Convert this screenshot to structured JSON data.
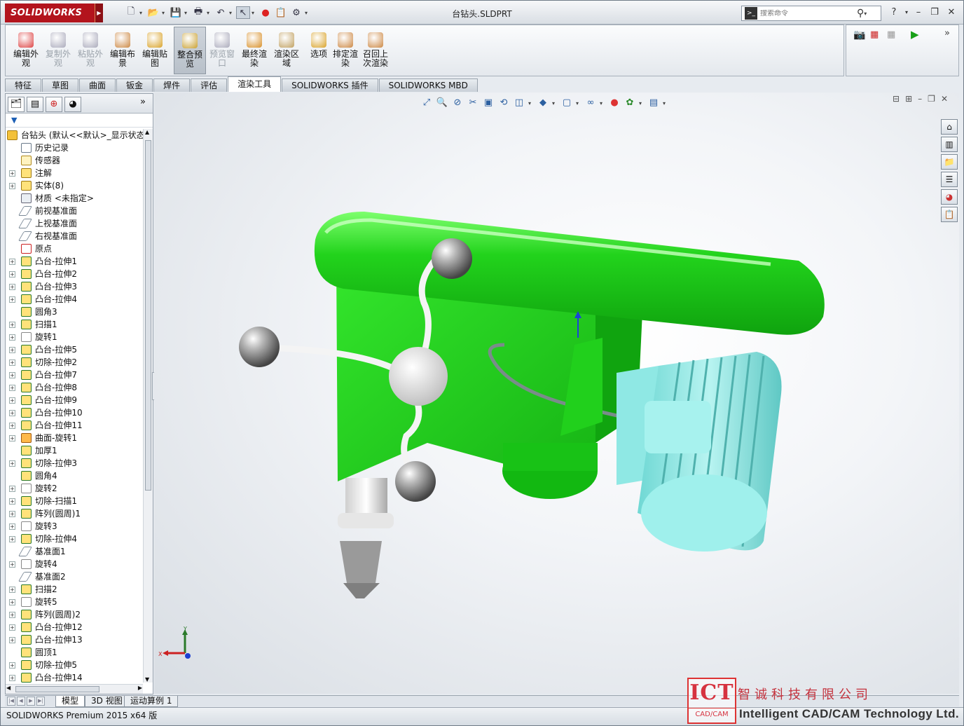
{
  "app": {
    "logo": "SOLIDWORKS",
    "document_title": "台钻头.SLDPRT"
  },
  "search": {
    "placeholder": "搜索命令"
  },
  "ribbon": {
    "buttons": [
      {
        "label": "编辑外\n观",
        "state": "normal"
      },
      {
        "label": "复制外\n观",
        "state": "disabled"
      },
      {
        "label": "粘贴外\n观",
        "state": "disabled"
      },
      {
        "label": "编辑布\n景",
        "state": "normal"
      },
      {
        "label": "编辑贴\n图",
        "state": "normal"
      },
      {
        "label": "整合预\n览",
        "state": "active"
      },
      {
        "label": "预览窗\n口",
        "state": "disabled"
      },
      {
        "label": "最终渲\n染",
        "state": "normal"
      },
      {
        "label": "渲染区\n域",
        "state": "normal"
      },
      {
        "label": "选项",
        "state": "normal"
      },
      {
        "label": "排定渲\n染",
        "state": "normal"
      },
      {
        "label": "召回上\n次渲染",
        "state": "normal"
      }
    ]
  },
  "tabs": [
    "特征",
    "草图",
    "曲面",
    "钣金",
    "焊件",
    "评估",
    "渲染工具",
    "SOLIDWORKS 插件",
    "SOLIDWORKS MBD"
  ],
  "active_tab": "渲染工具",
  "feature_tree": {
    "root": "台钻头  (默认<<默认>_显示状态",
    "items": [
      {
        "label": "历史记录",
        "expand": false,
        "icon": "history-icon"
      },
      {
        "label": "传感器",
        "expand": false,
        "icon": "sensor-icon"
      },
      {
        "label": "注解",
        "expand": true,
        "icon": "annotation-icon"
      },
      {
        "label": "实体(8)",
        "expand": true,
        "icon": "solid-body-icon"
      },
      {
        "label": "材质 <未指定>",
        "expand": false,
        "icon": "material-icon"
      },
      {
        "label": "前视基准面",
        "expand": false,
        "icon": "plane-icon"
      },
      {
        "label": "上视基准面",
        "expand": false,
        "icon": "plane-icon"
      },
      {
        "label": "右视基准面",
        "expand": false,
        "icon": "plane-icon"
      },
      {
        "label": "原点",
        "expand": false,
        "icon": "origin-icon"
      },
      {
        "label": "凸台-拉伸1",
        "expand": true,
        "icon": "boss-extrude-icon"
      },
      {
        "label": "凸台-拉伸2",
        "expand": true,
        "icon": "boss-extrude-icon"
      },
      {
        "label": "凸台-拉伸3",
        "expand": true,
        "icon": "boss-extrude-icon"
      },
      {
        "label": "凸台-拉伸4",
        "expand": true,
        "icon": "boss-extrude-icon"
      },
      {
        "label": "圆角3",
        "expand": false,
        "icon": "fillet-icon"
      },
      {
        "label": "扫描1",
        "expand": true,
        "icon": "sweep-icon"
      },
      {
        "label": "旋转1",
        "expand": true,
        "icon": "revolve-icon"
      },
      {
        "label": "凸台-拉伸5",
        "expand": true,
        "icon": "boss-extrude-icon"
      },
      {
        "label": "切除-拉伸2",
        "expand": true,
        "icon": "cut-extrude-icon"
      },
      {
        "label": "凸台-拉伸7",
        "expand": true,
        "icon": "boss-extrude-icon"
      },
      {
        "label": "凸台-拉伸8",
        "expand": true,
        "icon": "boss-extrude-icon"
      },
      {
        "label": "凸台-拉伸9",
        "expand": true,
        "icon": "boss-extrude-icon"
      },
      {
        "label": "凸台-拉伸10",
        "expand": true,
        "icon": "boss-extrude-icon"
      },
      {
        "label": "凸台-拉伸11",
        "expand": true,
        "icon": "boss-extrude-icon"
      },
      {
        "label": "曲面-旋转1",
        "expand": true,
        "icon": "surface-revolve-icon"
      },
      {
        "label": "加厚1",
        "expand": false,
        "icon": "thicken-icon"
      },
      {
        "label": "切除-拉伸3",
        "expand": true,
        "icon": "cut-extrude-icon"
      },
      {
        "label": "圆角4",
        "expand": false,
        "icon": "fillet-icon"
      },
      {
        "label": "旋转2",
        "expand": true,
        "icon": "revolve-icon"
      },
      {
        "label": "切除-扫描1",
        "expand": true,
        "icon": "cut-sweep-icon"
      },
      {
        "label": "阵列(圆周)1",
        "expand": true,
        "icon": "circular-pattern-icon"
      },
      {
        "label": "旋转3",
        "expand": true,
        "icon": "revolve-icon"
      },
      {
        "label": "切除-拉伸4",
        "expand": true,
        "icon": "cut-extrude-icon"
      },
      {
        "label": "基准面1",
        "expand": false,
        "icon": "plane-icon"
      },
      {
        "label": "旋转4",
        "expand": true,
        "icon": "revolve-icon"
      },
      {
        "label": "基准面2",
        "expand": false,
        "icon": "plane-icon"
      },
      {
        "label": "扫描2",
        "expand": true,
        "icon": "sweep-icon"
      },
      {
        "label": "旋转5",
        "expand": true,
        "icon": "revolve-icon"
      },
      {
        "label": "阵列(圆周)2",
        "expand": true,
        "icon": "circular-pattern-icon"
      },
      {
        "label": "凸台-拉伸12",
        "expand": true,
        "icon": "boss-extrude-icon"
      },
      {
        "label": "凸台-拉伸13",
        "expand": true,
        "icon": "boss-extrude-icon"
      },
      {
        "label": "圆顶1",
        "expand": false,
        "icon": "dome-icon"
      },
      {
        "label": "切除-拉伸5",
        "expand": true,
        "icon": "cut-extrude-icon"
      },
      {
        "label": "凸台-拉伸14",
        "expand": true,
        "icon": "boss-extrude-icon"
      }
    ]
  },
  "bottom_tabs": [
    "模型",
    "3D 视图",
    "运动算例 1"
  ],
  "status": "SOLIDWORKS Premium 2015 x64 版",
  "triad": {
    "x": "X",
    "y": "Y"
  },
  "watermark": {
    "logo": "ICT",
    "logo_sub": "CAD/CAM",
    "cn": "智诚科技有限公司",
    "en": "Intelligent CAD/CAM Technology Ltd."
  },
  "colors": {
    "body_green": "#22d31c",
    "motor_cyan": "#8fe8e4",
    "chrome": "#9a9a9a",
    "brand_red": "#b3141d"
  }
}
